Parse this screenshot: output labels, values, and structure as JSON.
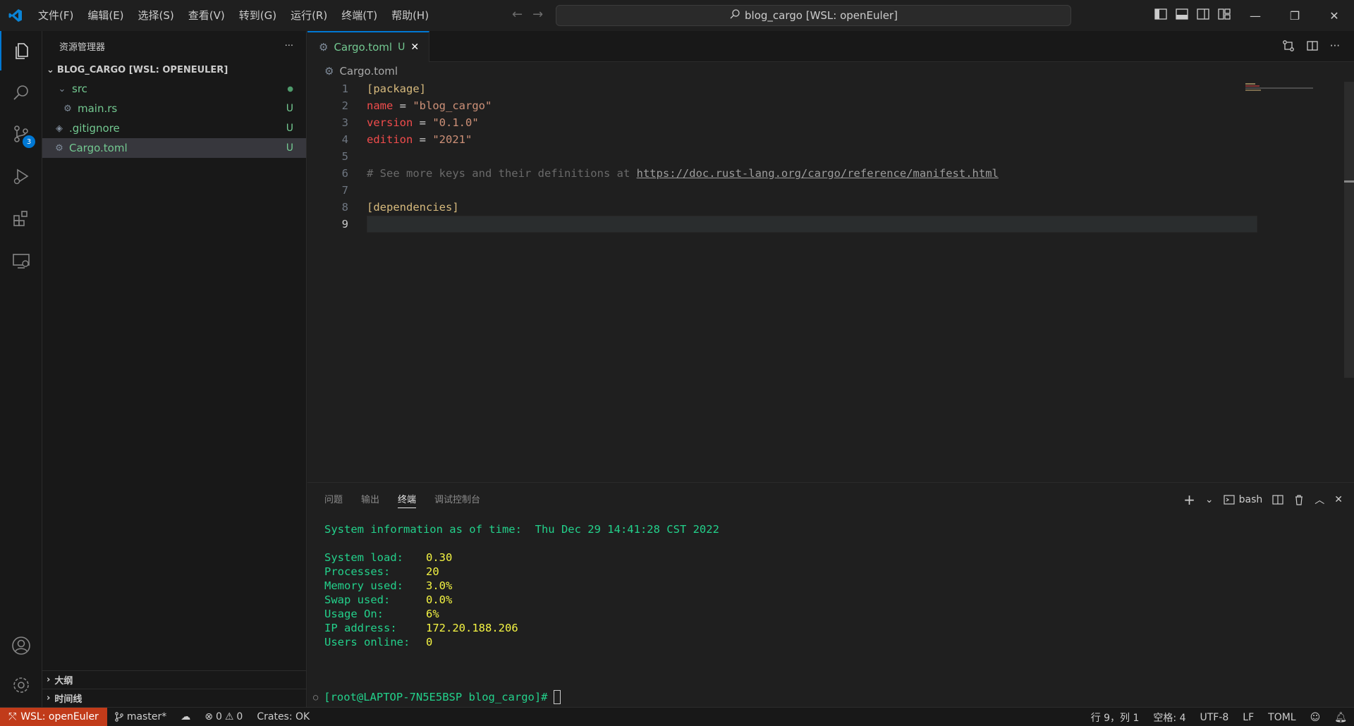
{
  "titlebar": {
    "menus": [
      "文件(F)",
      "编辑(E)",
      "选择(S)",
      "查看(V)",
      "转到(G)",
      "运行(R)",
      "终端(T)",
      "帮助(H)"
    ],
    "command_center": "blog_cargo [WSL: openEuler]"
  },
  "sidebar": {
    "title": "资源管理器",
    "workspace": "BLOG_CARGO [WSL: OPENEULER]",
    "tree": [
      {
        "label": "src",
        "status": "●"
      },
      {
        "label": "main.rs",
        "status": "U"
      },
      {
        "label": ".gitignore",
        "status": "U"
      },
      {
        "label": "Cargo.toml",
        "status": "U"
      }
    ],
    "outline": "大纲",
    "timeline": "时间线"
  },
  "activity": {
    "scm_badge": "3"
  },
  "editor": {
    "tab_label": "Cargo.toml",
    "tab_status": "U",
    "breadcrumb": "Cargo.toml",
    "lines": [
      {
        "n": "1",
        "sec": "[package]"
      },
      {
        "n": "2",
        "key": "name",
        "eq": " = ",
        "val": "\"blog_cargo\""
      },
      {
        "n": "3",
        "key": "version",
        "eq": " = ",
        "val": "\"0.1.0\""
      },
      {
        "n": "4",
        "key": "edition",
        "eq": " = ",
        "val": "\"2021\""
      },
      {
        "n": "5"
      },
      {
        "n": "6",
        "comment": "# See more keys and their definitions at ",
        "url": "https://doc.rust-lang.org/cargo/reference/manifest.html"
      },
      {
        "n": "7"
      },
      {
        "n": "8",
        "sec": "[dependencies]"
      },
      {
        "n": "9"
      }
    ]
  },
  "panel": {
    "tabs": [
      "问题",
      "输出",
      "终端",
      "调试控制台"
    ],
    "shell": "bash",
    "terminal": {
      "header_label": "System information as of time:",
      "header_value": "Thu Dec 29 14:41:28 CST 2022",
      "rows": [
        {
          "label": "System load:",
          "value": "0.30"
        },
        {
          "label": "Processes:",
          "value": "20"
        },
        {
          "label": "Memory used:",
          "value": "3.0%"
        },
        {
          "label": "Swap used:",
          "value": "0.0%"
        },
        {
          "label": "Usage On:",
          "value": "6%"
        },
        {
          "label": "IP address:",
          "value": "172.20.188.206"
        },
        {
          "label": "Users online:",
          "value": "0"
        }
      ],
      "prompt": "[root@LAPTOP-7N5E5BSP blog_cargo]#"
    }
  },
  "statusbar": {
    "remote": "WSL: openEuler",
    "branch": "master*",
    "errors": "0",
    "warnings": "0",
    "crates": "Crates: OK",
    "position": "行 9，列 1",
    "spaces": "空格: 4",
    "encoding": "UTF-8",
    "eol": "LF",
    "language": "TOML"
  },
  "colors": {
    "accent": "#0078d4",
    "remote_bg": "#c13b1a",
    "git_untracked": "#73c991"
  }
}
